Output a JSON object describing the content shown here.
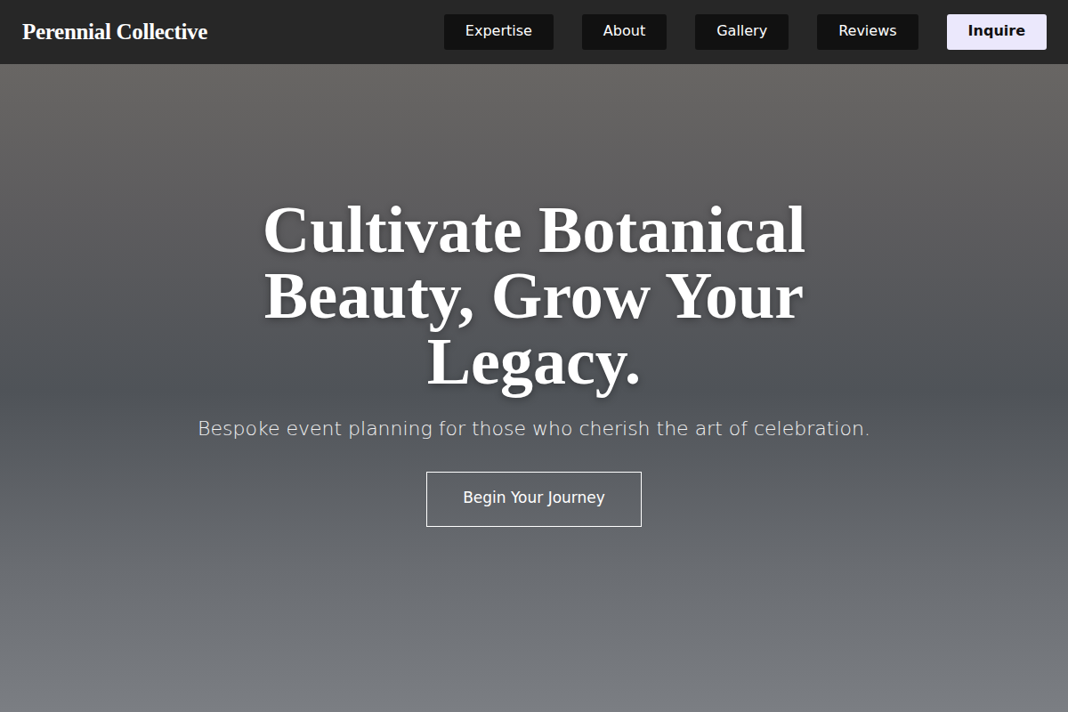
{
  "brand": "Perennial Collective",
  "nav": [
    {
      "label": "Expertise",
      "kind": "link"
    },
    {
      "label": "About",
      "kind": "link"
    },
    {
      "label": "Gallery",
      "kind": "link"
    },
    {
      "label": "Reviews",
      "kind": "link"
    },
    {
      "label": "Inquire",
      "kind": "cta"
    }
  ],
  "hero": {
    "title": "Cultivate Botanical Beauty, Grow Your Legacy.",
    "subtitle": "Bespoke event planning for those who cherish the art of celebration.",
    "button": "Begin Your Journey"
  }
}
